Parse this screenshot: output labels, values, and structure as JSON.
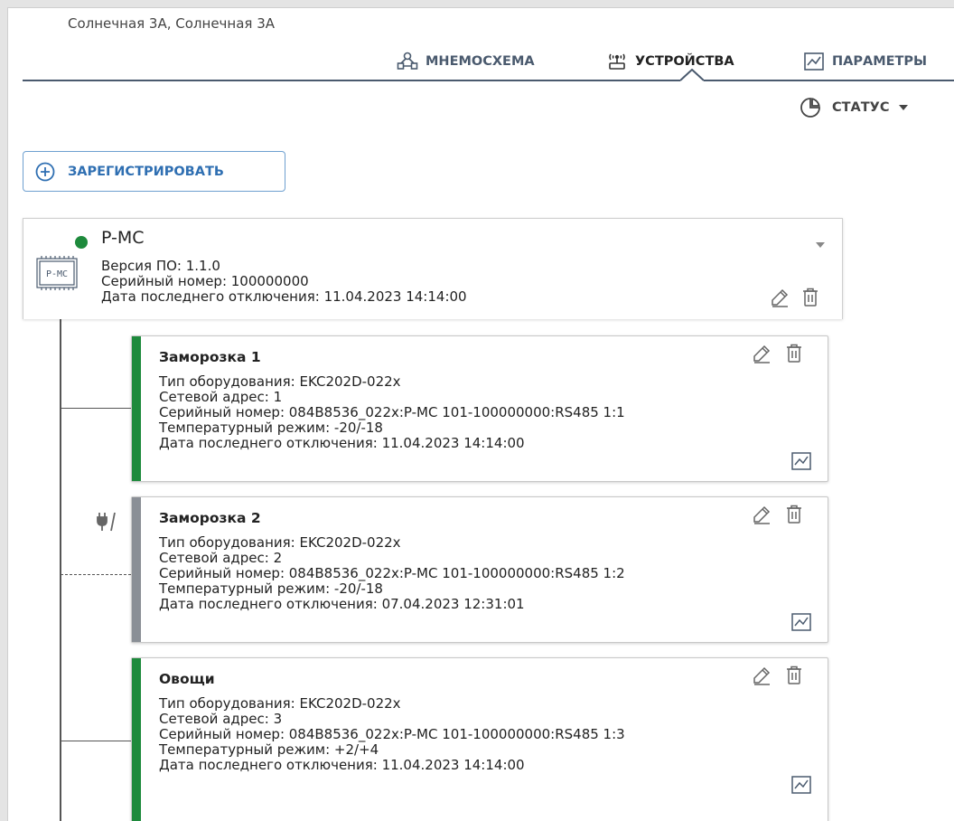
{
  "header": {
    "location": "Солнечная 3А, Солнечная 3А"
  },
  "tabs": [
    {
      "label": "МНЕМОСХЕМА",
      "icon": "mnemonic-icon",
      "active": false
    },
    {
      "label": "УСТРОЙСТВА",
      "icon": "devices-icon",
      "active": true
    },
    {
      "label": "ПАРАМЕТРЫ",
      "icon": "parameters-icon",
      "active": false
    }
  ],
  "status": {
    "label": "СТАТУС",
    "icon": "pie-chart-icon"
  },
  "register": {
    "label": "ЗАРЕГИСТРИРОВАТЬ",
    "icon": "plus-circle-icon"
  },
  "colors": {
    "accent": "#2f6fb2",
    "online": "#1e8a3c",
    "offline": "#8a8f96",
    "tab_text": "#4a5a6e"
  },
  "device": {
    "name": "P-MC",
    "badge": "P-MC",
    "status": "online",
    "lines": [
      "Версия ПО: 1.1.0",
      "Серийный номер: 100000000",
      "Дата последнего отключения: 11.04.2023 14:14:00"
    ]
  },
  "controllers": [
    {
      "title": "Заморозка 1",
      "status": "online",
      "lines": [
        "Тип оборудования: EKC202D-022x",
        "Сетевой адрес: 1",
        "Серийный номер: 084B8536_022x:P-MC 101-100000000:RS485 1:1",
        "Температурный режим: -20/-18",
        "Дата последнего отключения: 11.04.2023 14:14:00"
      ]
    },
    {
      "title": "Заморозка 2",
      "status": "offline",
      "lines": [
        "Тип оборудования: EKC202D-022x",
        "Сетевой адрес: 2",
        "Серийный номер: 084B8536_022x:P-MC 101-100000000:RS485 1:2",
        "Температурный режим: -20/-18",
        "Дата последнего отключения: 07.04.2023 12:31:01"
      ]
    },
    {
      "title": "Овощи",
      "status": "online",
      "lines": [
        "Тип оборудования: EKC202D-022x",
        "Сетевой адрес: 3",
        "Серийный номер: 084B8536_022x:P-MC 101-100000000:RS485 1:3",
        "Температурный режим: +2/+4",
        "Дата последнего отключения: 11.04.2023 14:14:00"
      ]
    }
  ]
}
